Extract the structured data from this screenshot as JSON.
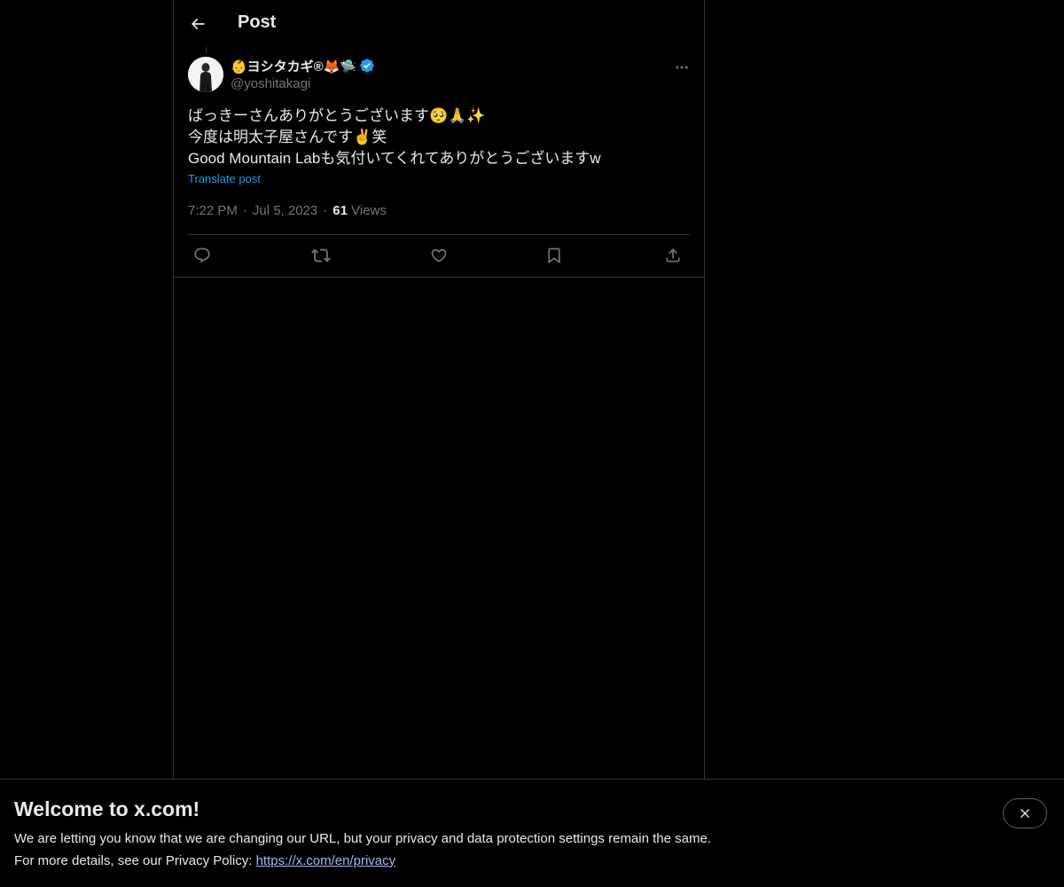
{
  "header": {
    "title": "Post",
    "back_icon": "arrow-left-icon"
  },
  "post": {
    "author": {
      "display_name": "👶ヨシタカギ®🦊🛸",
      "handle": "@yoshitakagi",
      "verified": true,
      "verified_color": "#1d9bf0"
    },
    "text_lines": [
      "ばっきーさんありがとうございます🥺🙏✨",
      "今度は明太子屋さんです✌️笑",
      "Good Mountain Labも気付いてくれてありがとうございますw"
    ],
    "translate_label": "Translate post",
    "time": "7:22 PM",
    "separator": "·",
    "date": "Jul 5, 2023",
    "views_count": "61",
    "views_label": "Views",
    "actions": [
      "reply-icon",
      "repost-icon",
      "like-icon",
      "bookmark-icon",
      "share-icon"
    ]
  },
  "banner": {
    "title": "Welcome to x.com!",
    "line1": "We are letting you know that we are changing our URL, but your privacy and data protection settings remain the same.",
    "line2_prefix": "For more details, see our Privacy Policy: ",
    "link_text": "https://x.com/en/privacy"
  },
  "colors": {
    "background": "#000000",
    "text": "#e7e9ea",
    "muted": "#71767b",
    "accent": "#1d9bf0",
    "border": "#2f3336"
  }
}
